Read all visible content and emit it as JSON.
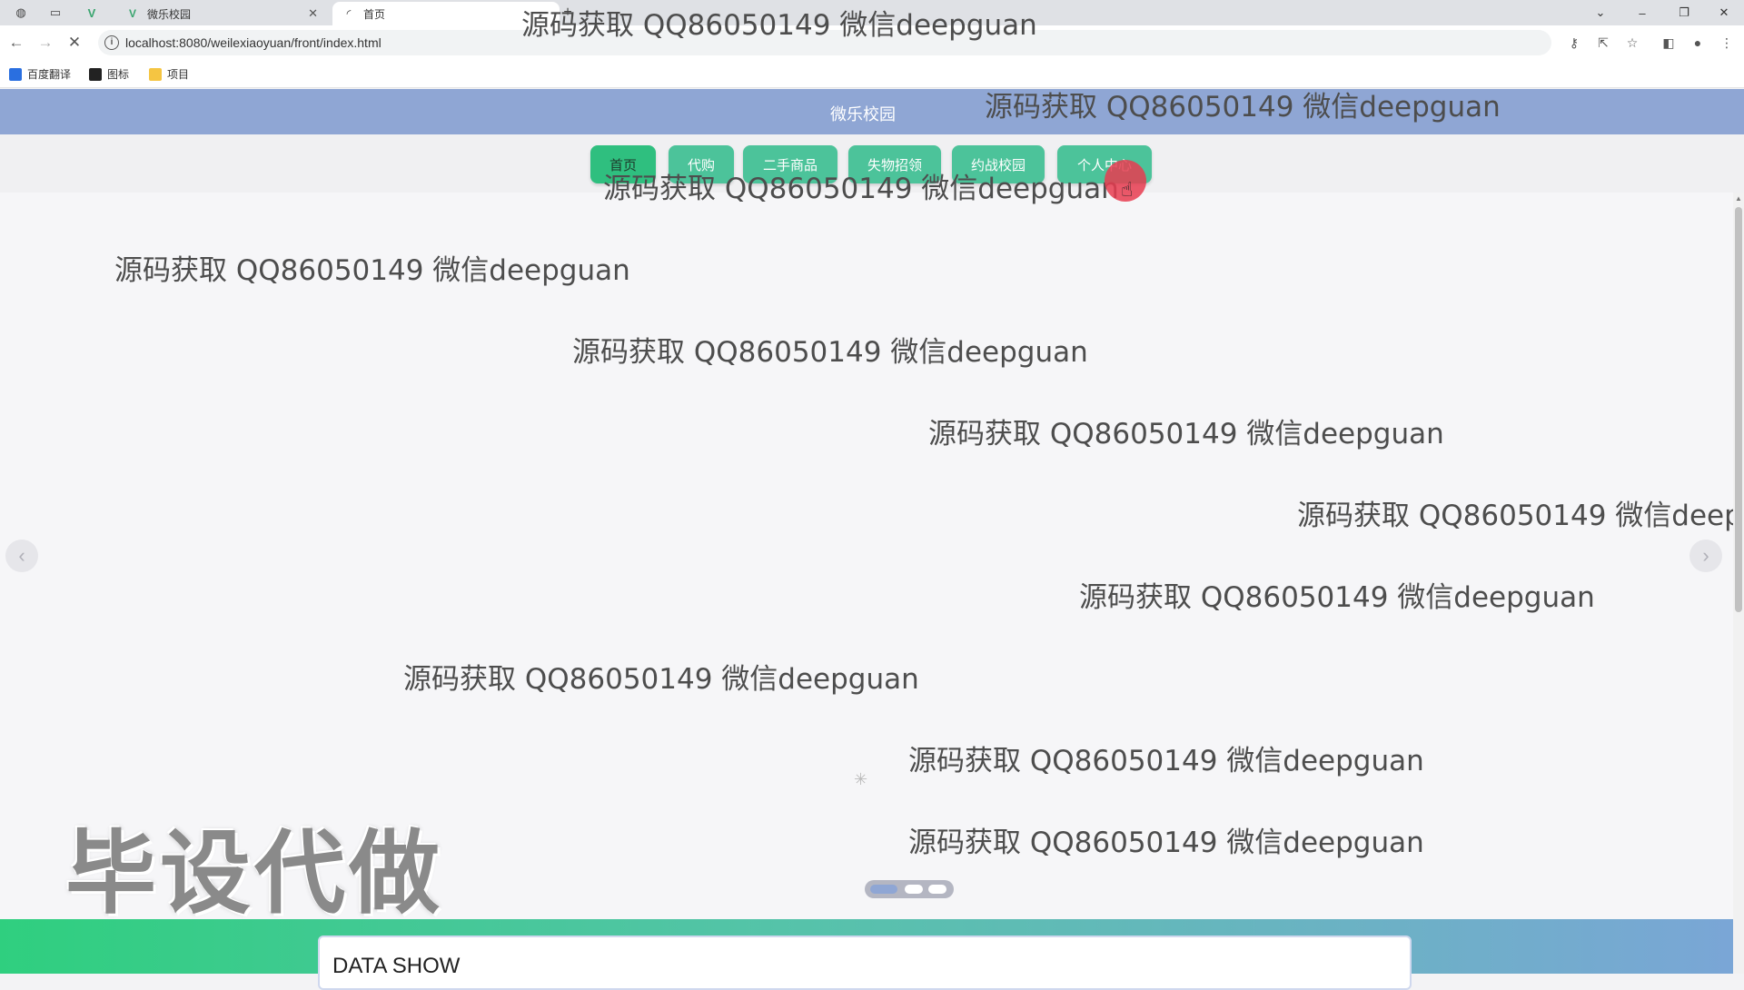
{
  "browser": {
    "tabs": [
      {
        "title": "微乐校园",
        "active": false
      },
      {
        "title": "首页",
        "active": true
      }
    ],
    "url": "localhost:8080/weilexiaoyuan/front/index.html",
    "bookmarks": [
      "百度翻译",
      "图标",
      "项目"
    ]
  },
  "site": {
    "title": "微乐校园",
    "nav": [
      {
        "label": "首页",
        "active": true
      },
      {
        "label": "代购",
        "active": false
      },
      {
        "label": "二手商品",
        "active": false
      },
      {
        "label": "失物招领",
        "active": false
      },
      {
        "label": "约战校园",
        "active": false
      },
      {
        "label": "个人中心",
        "active": false
      }
    ]
  },
  "carousel": {
    "slide_count": 3,
    "active_index": 0
  },
  "watermark_text": "源码获取 QQ86050149 微信deepguan",
  "stamp_text": "毕设代做",
  "section": {
    "title": "DATA SHOW"
  },
  "colors": {
    "header": "#8fa6d4",
    "nav_button": "#4cc39a",
    "nav_active": "#2fbf7f",
    "band_start": "#2fcf7f",
    "band_end": "#7aa6d6"
  }
}
